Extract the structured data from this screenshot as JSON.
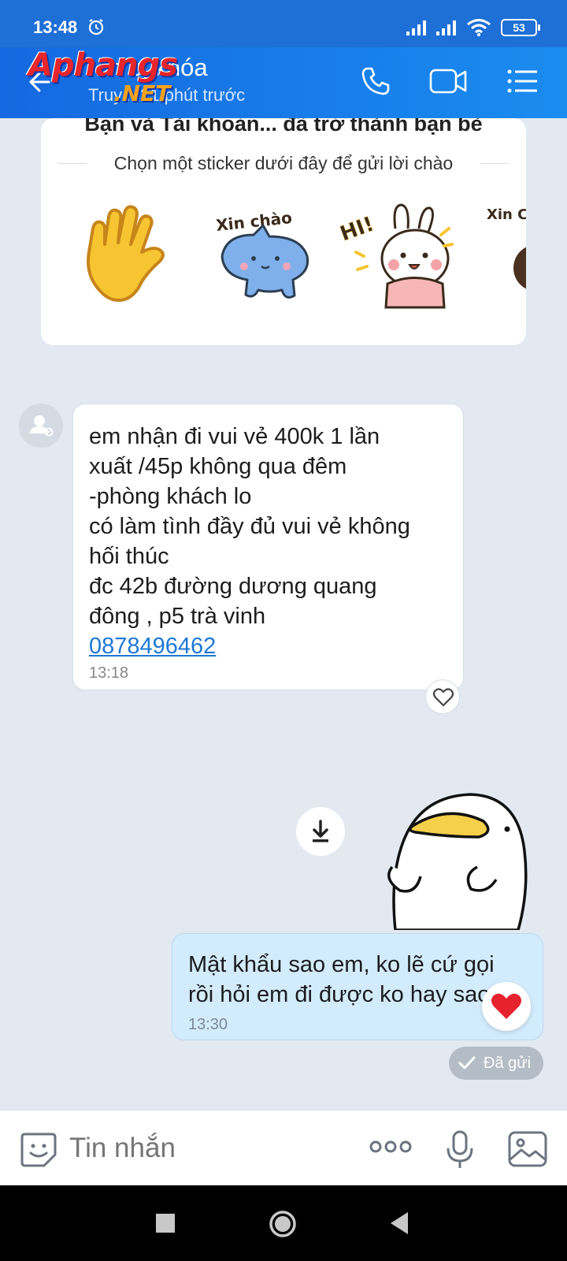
{
  "status_bar": {
    "time": "13:48",
    "battery": "53",
    "icons": [
      "alarm-icon",
      "cell-signal-icon",
      "cell-signal-icon",
      "wifi-icon",
      "battery-icon"
    ]
  },
  "header": {
    "title": "...n bị khóa",
    "subtitle": "Truy... 21 phút trước",
    "watermark_main": "Aphangs",
    "watermark_sub": ".NET",
    "icons": [
      "back-arrow-icon",
      "phone-call-icon",
      "video-call-icon",
      "menu-list-icon"
    ]
  },
  "sticker_card": {
    "title": "Bạn và Tài khoản...  đã trở thành bạn bè",
    "subtitle": "Chọn một sticker dưới đây để gửi lời chào",
    "stickers": [
      {
        "name": "waving-hand-sticker",
        "text": ""
      },
      {
        "name": "blue-cat-sticker",
        "text": "Xin chào"
      },
      {
        "name": "bunny-hi-sticker",
        "text": "HI!"
      },
      {
        "name": "xin-chao-sticker",
        "text": "Xin Chà"
      }
    ]
  },
  "incoming_message": {
    "lines": [
      "em nhận đi vui vẻ 400k 1 lần",
      "xuất /45p không qua đêm",
      "-phòng khách lo",
      "có làm tình đầy đủ vui vẻ không",
      "hối thúc",
      "đc 42b đường dương quang",
      "đông , p5 trà vinh"
    ],
    "phone": "0878496462",
    "time": "13:18"
  },
  "outgoing_message": {
    "lines": [
      "Mật khẩu sao em, ko lẽ cứ gọi",
      "rồi hỏi em đi được ko hay sao"
    ],
    "time": "13:30",
    "status": "Đã gửi",
    "reaction": "heart"
  },
  "input_bar": {
    "placeholder": "Tin nhắn",
    "icons": [
      "emoji-sticker-icon",
      "more-dots-icon",
      "microphone-icon",
      "image-gallery-icon"
    ]
  },
  "nav_bar": {
    "icons": [
      "recents-square-icon",
      "home-circle-icon",
      "back-triangle-icon"
    ]
  },
  "colors": {
    "header_blue": "#1a7ee8",
    "chat_background": "#e2e9f1",
    "outgoing_bubble": "#d3ecfd",
    "link_blue": "#1d78d6"
  }
}
